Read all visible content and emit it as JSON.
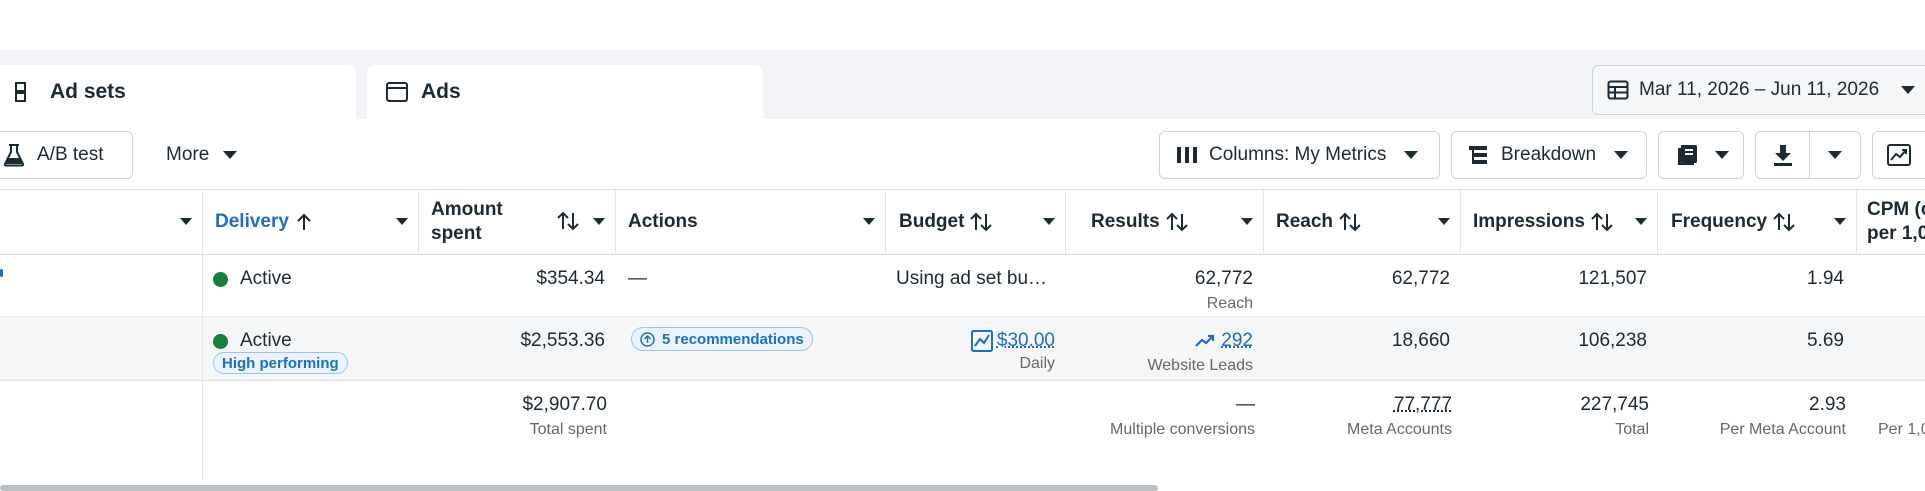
{
  "tabs": {
    "ad_sets": "Ad sets",
    "ads": "Ads"
  },
  "date_range": "Mar 11, 2026 – Jun 11, 2026",
  "toolbar": {
    "ab_test": "A/B test",
    "more": "More",
    "columns": "Columns: My Metrics",
    "breakdown": "Breakdown"
  },
  "columns": {
    "delivery": "Delivery",
    "amount_spent_1": "Amount",
    "amount_spent_2": "spent",
    "actions": "Actions",
    "budget": "Budget",
    "results": "Results",
    "reach": "Reach",
    "impressions": "Impressions",
    "frequency": "Frequency",
    "cpm_1": "CPM (c",
    "cpm_2": "per 1,0"
  },
  "rows": [
    {
      "delivery": "Active",
      "amount_spent": "$354.34",
      "actions": "—",
      "budget": "Using ad set bu…",
      "results": "62,772",
      "results_sub": "Reach",
      "reach": "62,772",
      "impressions": "121,507",
      "frequency": "1.94"
    },
    {
      "delivery": "Active",
      "badge": "High performing",
      "amount_spent": "$2,553.36",
      "actions": "5 recommendations",
      "budget": "$30.00",
      "budget_sub": "Daily",
      "results": "292",
      "results_sub": "Website Leads",
      "reach": "18,660",
      "impressions": "106,238",
      "frequency": "5.69"
    }
  ],
  "totals": {
    "amount_spent": "$2,907.70",
    "amount_spent_sub": "Total spent",
    "results": "—",
    "results_sub": "Multiple conversions",
    "reach": "77,777",
    "reach_sub": "Meta Accounts",
    "impressions": "227,745",
    "impressions_sub": "Total",
    "frequency": "2.93",
    "frequency_sub": "Per Meta Account",
    "cpm_sub": "Per 1,0"
  },
  "colors": {
    "accent": "#1f6fbf",
    "active_dot": "#16803c",
    "border": "#cbd2d9"
  }
}
